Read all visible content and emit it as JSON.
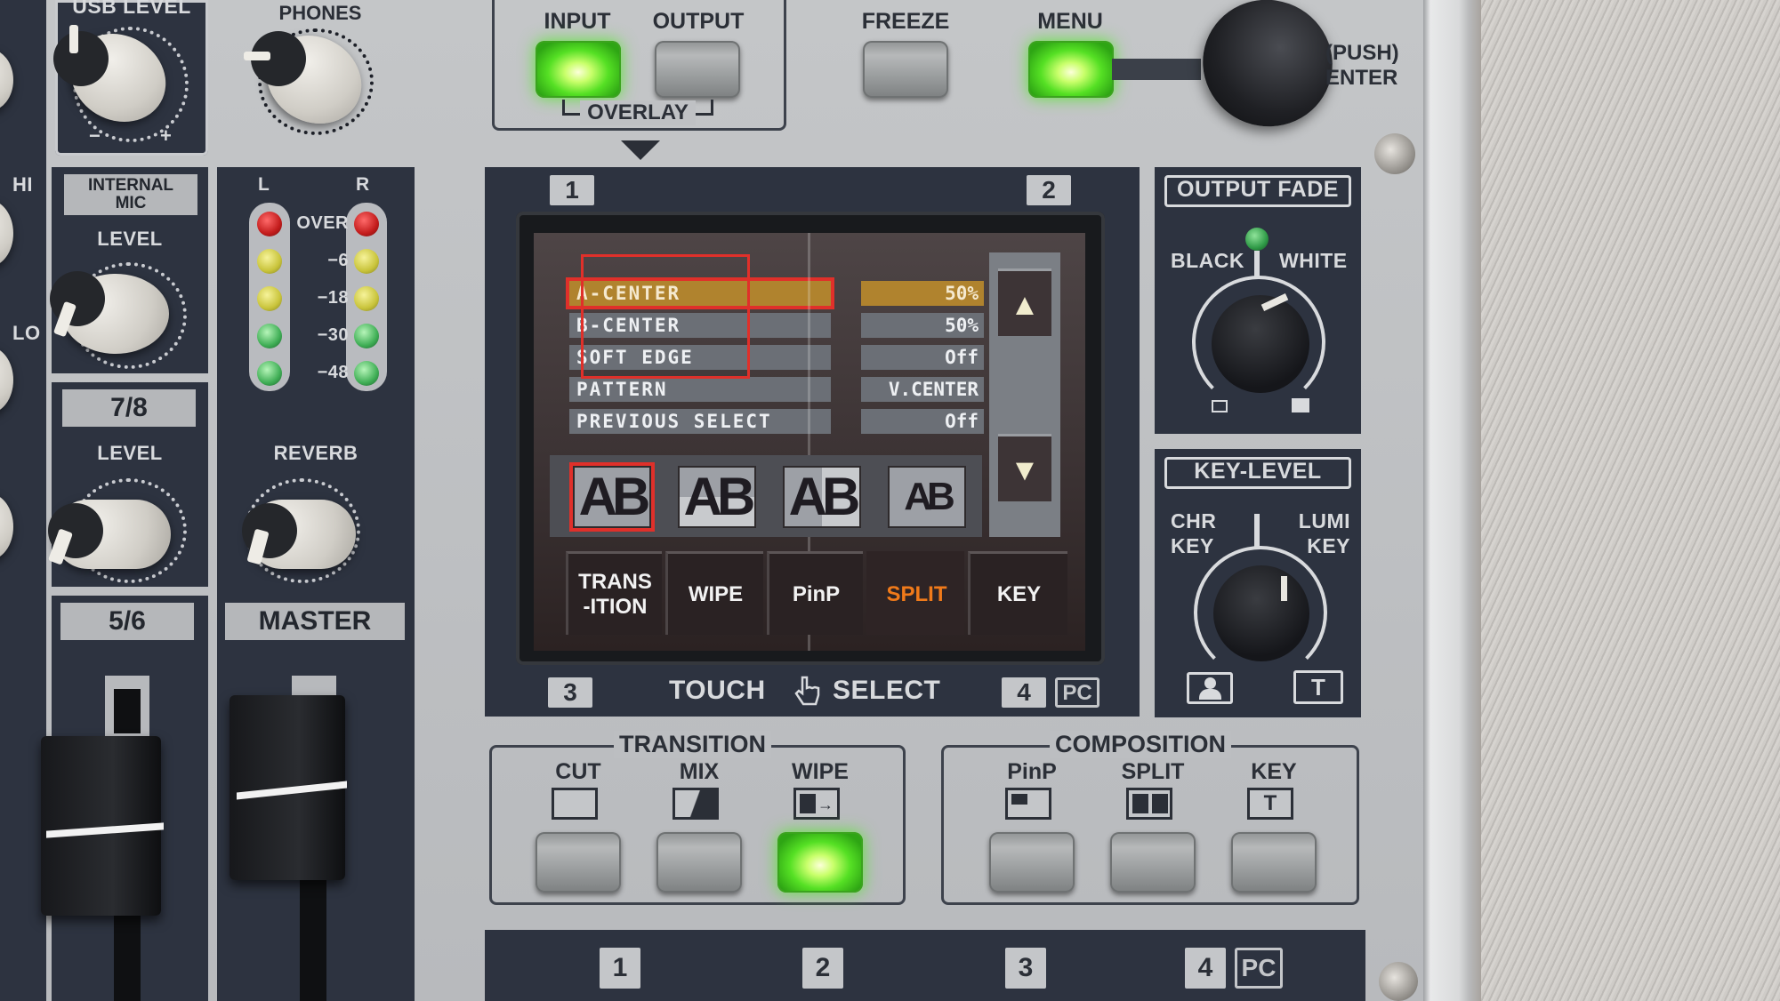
{
  "device": {
    "type": "video-mixer-front-panel",
    "colors": {
      "panel_navy": "#2d3340",
      "panel_silver": "#c0c2c5",
      "led_lit_green": "#55e024",
      "screen_highlight": "#b0832e",
      "active_tab": "#f07a1a",
      "selection_frame": "#e0302a"
    }
  },
  "audio": {
    "usb_level": {
      "label": "USB LEVEL",
      "min_label": "−",
      "max_label": "+"
    },
    "phones": {
      "label": "PHONES"
    },
    "eq_labels": {
      "hi": "HI",
      "lo": "LO"
    },
    "internal_mic": {
      "plate": "INTERNAL MIC",
      "knob_label": "LEVEL"
    },
    "ch78": {
      "plate": "7/8",
      "knob_label": "LEVEL"
    },
    "ch56": {
      "plate": "5/6"
    },
    "reverb": {
      "label": "REVERB"
    },
    "master": {
      "plate": "MASTER"
    },
    "meter": {
      "left_label": "L",
      "right_label": "R",
      "scale": [
        "OVER",
        "−6",
        "−18",
        "−30",
        "−48"
      ]
    }
  },
  "overlay": {
    "input_label": "INPUT",
    "output_label": "OUTPUT",
    "group_label": "OVERLAY",
    "input_lit": true,
    "output_lit": false
  },
  "freeze": {
    "label": "FREEZE",
    "lit": false
  },
  "menu": {
    "label": "MENU",
    "lit": true
  },
  "enter_knob": {
    "label_line1": "(PUSH)",
    "label_line2": "ENTER"
  },
  "screen": {
    "corner_tags": {
      "top_left": "1",
      "top_right": "2",
      "bottom_left": "3",
      "bottom_right": "4",
      "pc": "PC"
    },
    "caption_touch": "TOUCH",
    "caption_select": "SELECT",
    "rows": [
      {
        "name": "A-CENTER",
        "value": "50%",
        "selected": true
      },
      {
        "name": "B-CENTER",
        "value": "50%",
        "selected": false
      },
      {
        "name": "SOFT EDGE",
        "value": "Off",
        "selected": false
      },
      {
        "name": "PATTERN",
        "value": "V.CENTER",
        "selected": false
      },
      {
        "name": "PREVIOUS SELECT",
        "value": "Off",
        "selected": false
      }
    ],
    "patterns": [
      {
        "id": "v-center",
        "glyph": "AB",
        "selected": true
      },
      {
        "id": "h-center",
        "glyph": "AB",
        "selected": false
      },
      {
        "id": "v-split",
        "glyph": "AB",
        "selected": false
      },
      {
        "id": "h-split",
        "glyph": "AB",
        "selected": false
      }
    ],
    "scroll_up": "▲",
    "scroll_down": "▼",
    "tabs": [
      {
        "label_line1": "TRANS",
        "label_line2": "-ITION",
        "active": false
      },
      {
        "label_line1": "WIPE",
        "label_line2": "",
        "active": false
      },
      {
        "label_line1": "PinP",
        "label_line2": "",
        "active": false
      },
      {
        "label_line1": "SPLIT",
        "label_line2": "",
        "active": true
      },
      {
        "label_line1": "KEY",
        "label_line2": "",
        "active": false
      }
    ]
  },
  "output_fade": {
    "title": "OUTPUT FADE",
    "left": "BLACK",
    "right": "WHITE"
  },
  "key_level": {
    "title": "KEY-LEVEL",
    "left_line1": "CHR",
    "left_line2": "KEY",
    "right_line1": "LUMI",
    "right_line2": "KEY"
  },
  "transition": {
    "title": "TRANSITION",
    "buttons": [
      {
        "label": "CUT",
        "lit": false
      },
      {
        "label": "MIX",
        "lit": false
      },
      {
        "label": "WIPE",
        "lit": true
      }
    ]
  },
  "composition": {
    "title": "COMPOSITION",
    "buttons": [
      {
        "label": "PinP",
        "lit": false
      },
      {
        "label": "SPLIT",
        "lit": false
      },
      {
        "label": "KEY",
        "lit": false
      }
    ]
  },
  "input_select": {
    "tags": [
      "1",
      "2",
      "3",
      "4"
    ],
    "pc": "PC"
  }
}
